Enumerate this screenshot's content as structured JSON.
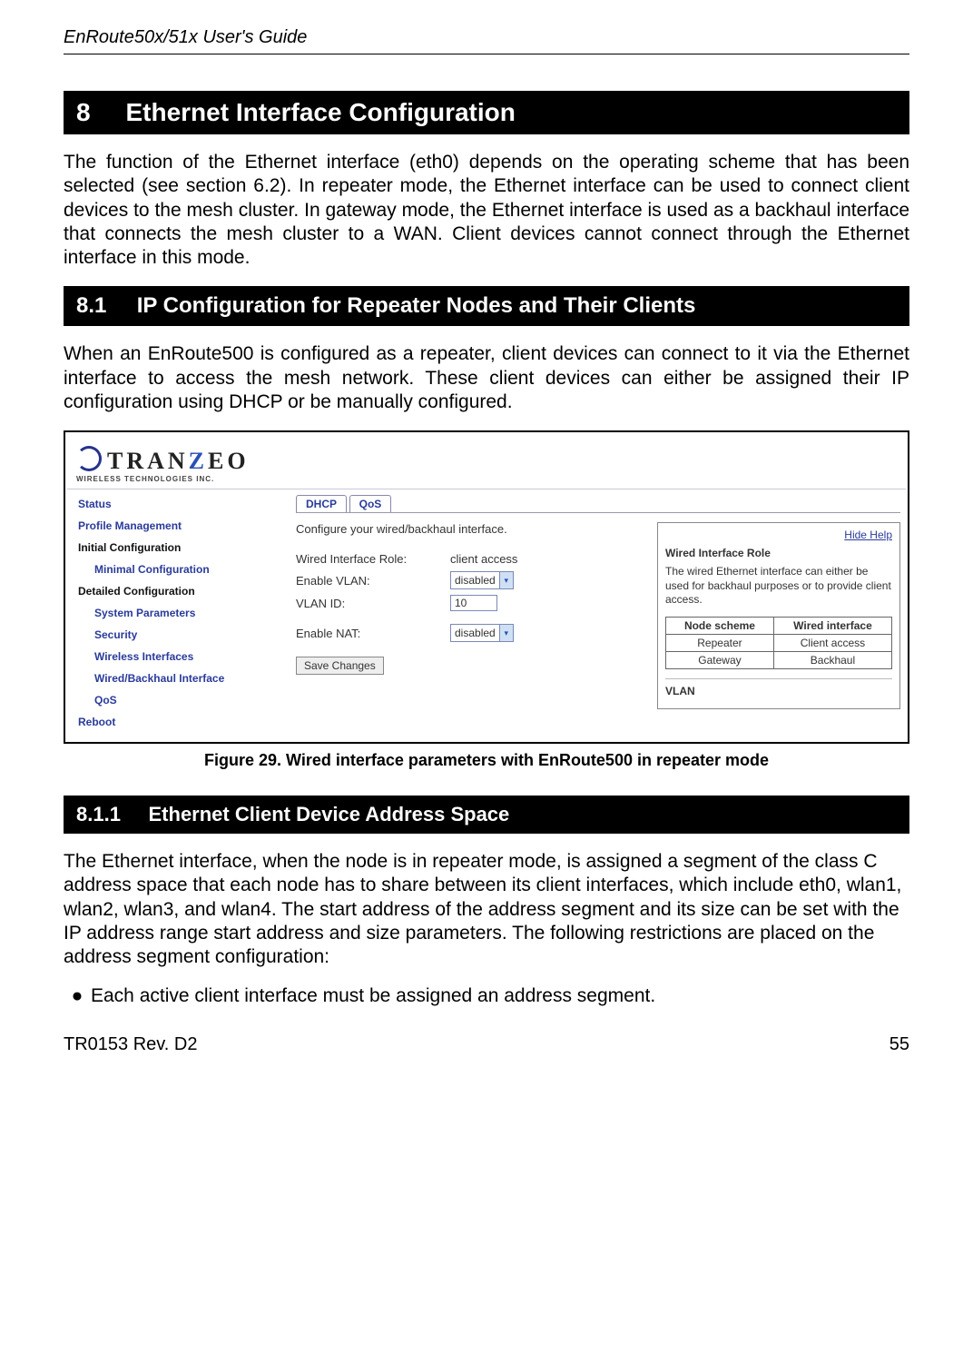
{
  "doc_header": "EnRoute50x/51x User's Guide",
  "section8": {
    "num": "8",
    "title": "Ethernet Interface Configuration",
    "intro": "The function of the Ethernet interface (eth0) depends on the operating scheme that has been selected (see section 6.2). In repeater mode, the Ethernet interface can be used to connect client devices to the mesh cluster. In gateway mode, the Ethernet interface is used as a backhaul interface that connects the mesh cluster to a WAN. Client devices cannot connect through the Ethernet interface in this mode."
  },
  "section81": {
    "num": "8.1",
    "title": "IP Configuration for Repeater Nodes and Their Clients",
    "intro": "When an EnRoute500 is configured as a repeater, client devices can connect to it via the Ethernet interface to access the mesh network. These client devices can either be assigned their IP configuration using DHCP or be manually configured."
  },
  "figure": {
    "caption": "Figure 29. Wired interface parameters with EnRoute500 in repeater mode",
    "logo_top_left": "TRAN",
    "logo_top_z": "Z",
    "logo_top_right": "EO",
    "logo_sub": "WIRELESS  TECHNOLOGIES INC.",
    "sidebar": {
      "items": [
        {
          "label": "Status",
          "cls": "side-item"
        },
        {
          "label": "Profile Management",
          "cls": "side-item"
        },
        {
          "label": "Initial Configuration",
          "cls": "side-item side-head"
        },
        {
          "label": "Minimal Configuration",
          "cls": "side-item side-sub"
        },
        {
          "label": "Detailed Configuration",
          "cls": "side-item side-head"
        },
        {
          "label": "System Parameters",
          "cls": "side-item side-sub"
        },
        {
          "label": "Security",
          "cls": "side-item side-sub"
        },
        {
          "label": "Wireless Interfaces",
          "cls": "side-item side-sub"
        },
        {
          "label": "Wired/Backhaul Interface",
          "cls": "side-item side-sub"
        },
        {
          "label": "QoS",
          "cls": "side-item side-sub"
        },
        {
          "label": "Reboot",
          "cls": "side-item"
        }
      ]
    },
    "tabs": {
      "dhcp": "DHCP",
      "qos": "QoS"
    },
    "form": {
      "desc": "Configure your wired/backhaul interface.",
      "role_label": "Wired Interface Role:",
      "role_value": "client access",
      "vlan_enable_label": "Enable VLAN:",
      "vlan_enable_value": "disabled",
      "vlan_id_label": "VLAN ID:",
      "vlan_id_value": "10",
      "nat_label": "Enable NAT:",
      "nat_value": "disabled",
      "save_btn": "Save Changes"
    },
    "help": {
      "hide_link": "Hide Help",
      "title": "Wired Interface Role",
      "text": "The wired Ethernet interface can either be used for backhaul purposes or to provide client access.",
      "table": {
        "h1": "Node scheme",
        "h2": "Wired interface",
        "r1c1": "Repeater",
        "r1c2": "Client access",
        "r2c1": "Gateway",
        "r2c2": "Backhaul"
      },
      "vlan_heading": "VLAN"
    }
  },
  "section811": {
    "num": "8.1.1",
    "title": "Ethernet Client Device Address Space",
    "intro": "The Ethernet interface, when the node is in repeater mode, is assigned a segment of the class C address space that each node has to share between its client interfaces, which include eth0, wlan1, wlan2, wlan3, and wlan4. The start address of the address segment and its size can be set with the IP address range start address and size parameters. The following restrictions are placed on the address segment configuration:",
    "bullet1": "Each active client interface must be assigned an address segment."
  },
  "footer": {
    "left": "TR0153 Rev. D2",
    "right": "55"
  }
}
